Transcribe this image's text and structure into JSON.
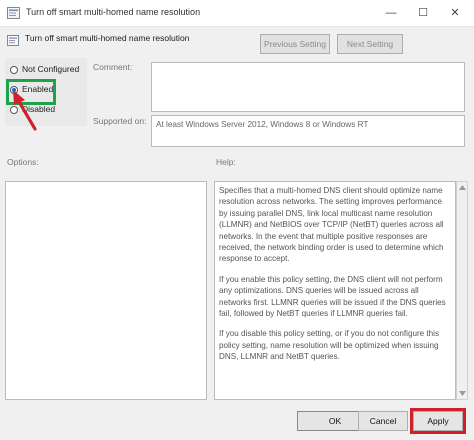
{
  "window": {
    "title": "Turn off smart multi-homed name resolution",
    "controls": {
      "minimize": "—",
      "maximize": "☐",
      "close": "✕"
    }
  },
  "header": {
    "setting_name": "Turn off smart multi-homed name resolution",
    "previous_label": "Previous Setting",
    "next_label": "Next Setting"
  },
  "state_options": {
    "not_configured": "Not Configured",
    "enabled": "Enabled",
    "disabled": "Disabled",
    "selected": "enabled"
  },
  "comment": {
    "label": "Comment:",
    "value": ""
  },
  "supported_on": {
    "label": "Supported on:",
    "value": "At least Windows Server 2012, Windows 8 or Windows RT"
  },
  "options": {
    "label": "Options:"
  },
  "help": {
    "label": "Help:",
    "paragraphs": [
      "Specifies that a multi-homed DNS client should optimize name resolution across networks.  The setting improves performance by issuing parallel DNS, link local multicast name resolution (LLMNR) and NetBIOS over TCP/IP (NetBT) queries across all networks. In the event that multiple positive responses are received, the network binding order is used to determine which response to accept.",
      "If you enable this policy setting, the DNS client will not perform any optimizations. DNS queries will be issued across all networks first. LLMNR queries will be issued if the DNS queries fail, followed by NetBT queries if LLMNR queries fail.",
      "If you disable this policy setting, or if you do not configure this policy setting, name resolution will be optimized when issuing DNS, LLMNR and NetBT queries."
    ]
  },
  "footer": {
    "ok_label": "OK",
    "cancel_label": "Cancel",
    "apply_label": "Apply"
  },
  "highlight_colors": {
    "enabled_box": "#1fa34a",
    "apply_box": "#d0202a",
    "arrow": "#d0202a"
  }
}
